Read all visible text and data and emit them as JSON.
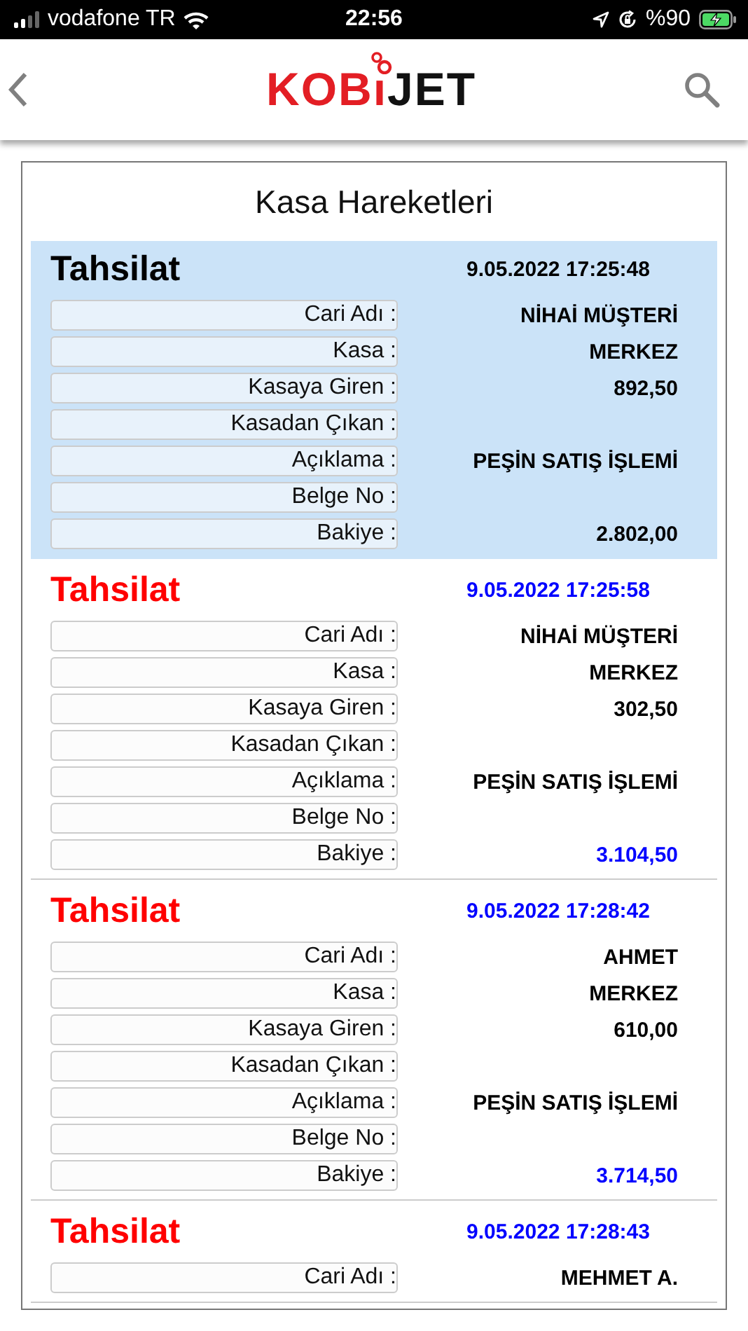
{
  "status_bar": {
    "carrier": "vodafone TR",
    "time": "22:56",
    "battery": "%90"
  },
  "header": {
    "logo": {
      "red_text": "KOBı",
      "black_text": "JET"
    }
  },
  "panel": {
    "title": "Kasa Hareketleri",
    "entries": [
      {
        "selected": true,
        "type": "Tahsilat",
        "date": "9.05.2022 17:25:48",
        "fields": [
          {
            "kind": "text",
            "label": "Cari Adı :",
            "value": "NİHAİ MÜŞTERİ"
          },
          {
            "kind": "text",
            "label": "Kasa :",
            "value": "MERKEZ"
          },
          {
            "kind": "text",
            "label": "Kasaya Giren :",
            "value": "892,50"
          },
          {
            "kind": "text",
            "label": "Kasadan Çıkan :"
          },
          {
            "kind": "text",
            "label": "Açıklama :",
            "value": "PEŞİN SATIŞ İŞLEMİ"
          },
          {
            "kind": "text",
            "label": "Belge No :"
          },
          {
            "kind": "balance",
            "label": "Bakiye :",
            "value": "2.802,00"
          }
        ]
      },
      {
        "selected": false,
        "type": "Tahsilat",
        "date": "9.05.2022 17:25:58",
        "fields": [
          {
            "kind": "text",
            "label": "Cari Adı :",
            "value": "NİHAİ MÜŞTERİ"
          },
          {
            "kind": "text",
            "label": "Kasa :",
            "value": "MERKEZ"
          },
          {
            "kind": "text",
            "label": "Kasaya Giren :",
            "value": "302,50"
          },
          {
            "kind": "text",
            "label": "Kasadan Çıkan :"
          },
          {
            "kind": "text",
            "label": "Açıklama :",
            "value": "PEŞİN SATIŞ İŞLEMİ"
          },
          {
            "kind": "text",
            "label": "Belge No :"
          },
          {
            "kind": "balance",
            "label": "Bakiye :",
            "value": "3.104,50"
          }
        ]
      },
      {
        "selected": false,
        "type": "Tahsilat",
        "date": "9.05.2022 17:28:42",
        "fields": [
          {
            "kind": "text",
            "label": "Cari Adı :",
            "value": "AHMET"
          },
          {
            "kind": "text",
            "label": "Kasa :",
            "value": "MERKEZ"
          },
          {
            "kind": "text",
            "label": "Kasaya Giren :",
            "value": "610,00"
          },
          {
            "kind": "text",
            "label": "Kasadan Çıkan :"
          },
          {
            "kind": "text",
            "label": "Açıklama :",
            "value": "PEŞİN SATIŞ İŞLEMİ"
          },
          {
            "kind": "text",
            "label": "Belge No :"
          },
          {
            "kind": "balance",
            "label": "Bakiye :",
            "value": "3.714,50"
          }
        ]
      },
      {
        "selected": false,
        "type": "Tahsilat",
        "date": "9.05.2022 17:28:43",
        "fields": [
          {
            "kind": "text",
            "label": "Cari Adı :",
            "value": "MEHMET A."
          }
        ]
      }
    ]
  }
}
